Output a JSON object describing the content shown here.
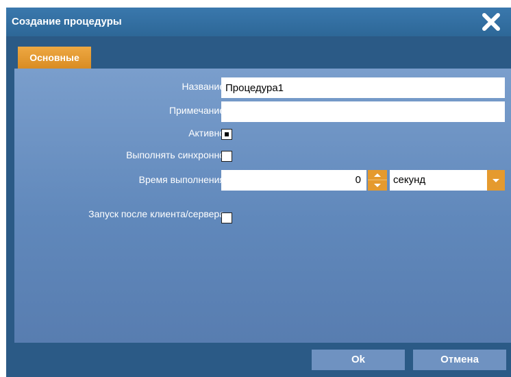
{
  "dialog": {
    "title": "Создание процедуры",
    "close_icon": "close-icon"
  },
  "tabs": [
    {
      "label": "Основные",
      "active": true
    }
  ],
  "form": {
    "name": {
      "label": "Название",
      "value": "Процедура1"
    },
    "note": {
      "label": "Примечание",
      "value": ""
    },
    "active": {
      "label": "Активно",
      "checked": true
    },
    "sync": {
      "label": "Выполнять синхронно",
      "checked": false
    },
    "exec_time": {
      "label": "Время выполнения",
      "value": "0",
      "unit": "секунд"
    },
    "after_client": {
      "label": "Запуск после клиента/сервера",
      "checked": false
    }
  },
  "buttons": {
    "ok": "Ok",
    "cancel": "Отмена"
  },
  "colors": {
    "accent": "#e59a2e",
    "titlebar": "#3572a5",
    "panel": "#6a90c2"
  }
}
